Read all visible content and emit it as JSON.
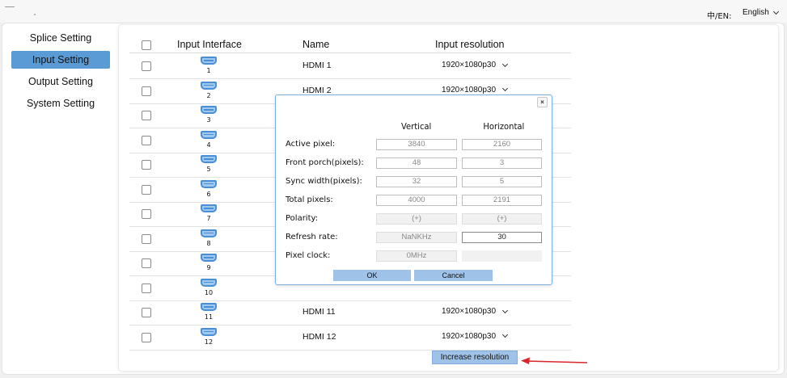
{
  "header": {
    "lang_label": "中/EN:",
    "lang_value": "English"
  },
  "sidebar": {
    "items": [
      {
        "label": "Splice Setting",
        "active": false
      },
      {
        "label": "Input Setting",
        "active": true
      },
      {
        "label": "Output Setting",
        "active": false
      },
      {
        "label": "System Setting",
        "active": false
      }
    ]
  },
  "table": {
    "headers": {
      "interface": "Input Interface",
      "name": "Name",
      "resolution": "Input resolution"
    },
    "rows": [
      {
        "num": "1",
        "name": "HDMI 1",
        "resolution": "1920×1080p30"
      },
      {
        "num": "2",
        "name": "HDMI 2",
        "resolution": "1920×1080p30"
      },
      {
        "num": "3",
        "name": "",
        "resolution": ""
      },
      {
        "num": "4",
        "name": "",
        "resolution": ""
      },
      {
        "num": "5",
        "name": "",
        "resolution": ""
      },
      {
        "num": "6",
        "name": "",
        "resolution": ""
      },
      {
        "num": "7",
        "name": "",
        "resolution": ""
      },
      {
        "num": "8",
        "name": "",
        "resolution": ""
      },
      {
        "num": "9",
        "name": "",
        "resolution": ""
      },
      {
        "num": "10",
        "name": "",
        "resolution": ""
      },
      {
        "num": "11",
        "name": "HDMI 11",
        "resolution": "1920×1080p30"
      },
      {
        "num": "12",
        "name": "HDMI 12",
        "resolution": "1920×1080p30"
      }
    ],
    "increase_button": "Increase resolution"
  },
  "modal": {
    "close": "×",
    "col_vertical": "Vertical",
    "col_horizontal": "Horizontal",
    "fields": [
      {
        "label": "Active pixel:",
        "v": "3840",
        "h": "2160"
      },
      {
        "label": "Front porch(pixels):",
        "v": "48",
        "h": "3"
      },
      {
        "label": "Sync width(pixels):",
        "v": "32",
        "h": "5"
      },
      {
        "label": "Total pixels:",
        "v": "4000",
        "h": "2191"
      },
      {
        "label": "Polarity:",
        "v": "(+)",
        "h": "(+)"
      },
      {
        "label": "Refresh rate:",
        "v": "NaNKHz",
        "h": "30"
      },
      {
        "label": "Pixel clock:",
        "v": "0MHz",
        "h": ""
      }
    ],
    "ok": "OK",
    "cancel": "Cancel"
  },
  "colors": {
    "accent": "#5b9bd5",
    "button": "#9fc3e8",
    "arrow": "#d9262b",
    "port_icon": "#4a8fd6"
  }
}
